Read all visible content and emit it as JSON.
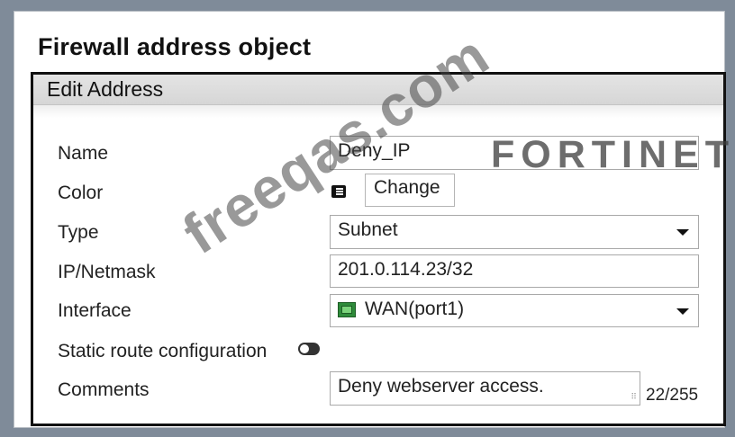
{
  "page_title": "Firewall address object",
  "panel": {
    "header": "Edit Address"
  },
  "form": {
    "name_label": "Name",
    "name_value": "Deny_IP",
    "color_label": "Color",
    "color_button": "Change",
    "type_label": "Type",
    "type_value": "Subnet",
    "ipmask_label": "IP/Netmask",
    "ipmask_value": "201.0.114.23/32",
    "interface_label": "Interface",
    "interface_value": "WAN(port1)",
    "static_route_label": "Static route configuration",
    "static_route_enabled": false,
    "comments_label": "Comments",
    "comments_value": "Deny webserver access.",
    "comments_counter": "22/255"
  },
  "overlay": {
    "watermark": "freeqas.com",
    "brand": "FORTINET"
  },
  "icons": {
    "color": "color-palette-icon",
    "interface": "network-port-icon",
    "dropdown": "chevron-down-icon",
    "toggle": "toggle-off-icon"
  }
}
